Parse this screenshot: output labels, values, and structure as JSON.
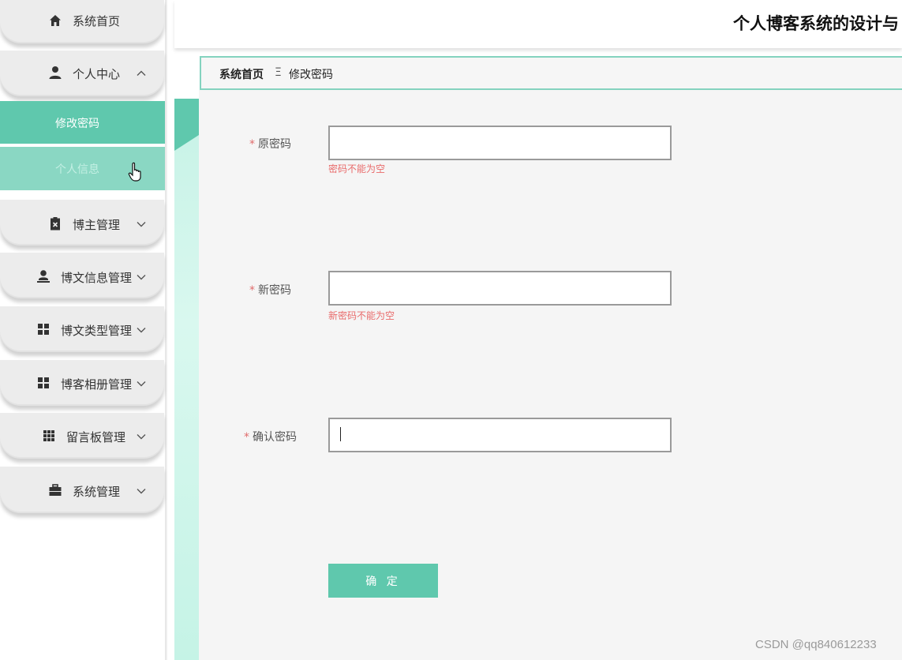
{
  "header": {
    "title": "个人博客系统的设计与"
  },
  "sidebar": {
    "items": [
      {
        "label": "系统首页",
        "icon": "home-icon"
      },
      {
        "label": "个人中心",
        "icon": "user-icon",
        "expanded": true,
        "children": [
          {
            "label": "修改密码",
            "active": true
          },
          {
            "label": "个人信息"
          }
        ]
      },
      {
        "label": "博主管理",
        "icon": "clipboard-icon"
      },
      {
        "label": "博文信息管理",
        "icon": "person-icon"
      },
      {
        "label": "博文类型管理",
        "icon": "grid-icon"
      },
      {
        "label": "博客相册管理",
        "icon": "grid-icon"
      },
      {
        "label": "留言板管理",
        "icon": "apps-icon"
      },
      {
        "label": "系统管理",
        "icon": "briefcase-icon"
      }
    ]
  },
  "breadcrumb": {
    "home": "系统首页",
    "separator": "Ξ",
    "current": "修改密码"
  },
  "form": {
    "required_mark": "*",
    "old_password": {
      "label": "原密码",
      "value": "",
      "error": "密码不能为空"
    },
    "new_password": {
      "label": "新密码",
      "value": "",
      "error": "新密码不能为空"
    },
    "confirm_password": {
      "label": "确认密码",
      "value": ""
    },
    "submit_label": "确 定"
  },
  "watermark": "CSDN @qq840612233",
  "colors": {
    "accent": "#5fc8ad",
    "accent_light": "#8ad7c3",
    "error": "#e96b6b",
    "border": "#84d3bf"
  }
}
